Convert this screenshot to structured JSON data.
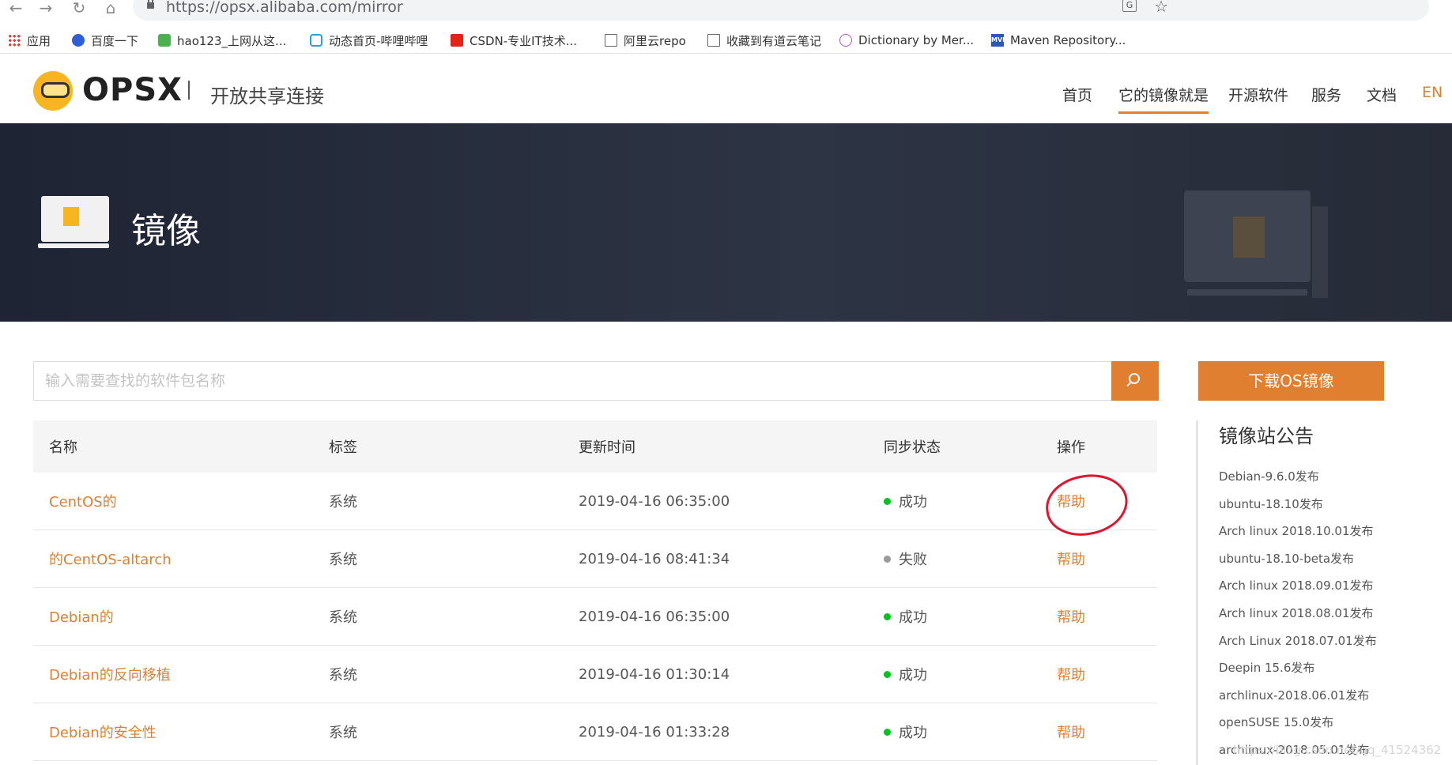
{
  "browser": {
    "url": "https://opsx.alibaba.com/mirror",
    "bookmarks": [
      {
        "label": "应用",
        "icon": "apps-icon"
      },
      {
        "label": "百度一下",
        "icon": "baidu-icon"
      },
      {
        "label": "hao123_上网从这...",
        "icon": "hao123-icon"
      },
      {
        "label": "动态首页-哔哩哔哩",
        "icon": "bilibili-icon"
      },
      {
        "label": "CSDN-专业IT技术...",
        "icon": "csdn-icon"
      },
      {
        "label": "阿里云repo",
        "icon": "page-icon"
      },
      {
        "label": "收藏到有道云笔记",
        "icon": "page-icon"
      },
      {
        "label": "Dictionary by Mer...",
        "icon": "dictionary-icon"
      },
      {
        "label": "Maven Repository...",
        "icon": "maven-icon"
      }
    ]
  },
  "header": {
    "logo_text": "OPSX",
    "slogan": "开放共享连接",
    "nav": [
      {
        "label": "首页"
      },
      {
        "label": "它的镜像就是"
      },
      {
        "label": "开源软件"
      },
      {
        "label": "服务"
      },
      {
        "label": "文档"
      },
      {
        "label": "EN"
      }
    ]
  },
  "banner": {
    "title": "镜像"
  },
  "search": {
    "placeholder": "输入需要查找的软件包名称"
  },
  "download_button": "下载OS镜像",
  "table": {
    "headers": [
      "名称",
      "标签",
      "更新时间",
      "同步状态",
      "操作"
    ],
    "rows": [
      {
        "name": "CentOS的",
        "tag": "系统",
        "time": "2019-04-16 06:35:00",
        "status": "成功",
        "op": "帮助"
      },
      {
        "name": "的CentOS-altarch",
        "tag": "系统",
        "time": "2019-04-16 08:41:34",
        "status": "失败",
        "op": "帮助"
      },
      {
        "name": "Debian的",
        "tag": "系统",
        "time": "2019-04-16 06:35:00",
        "status": "成功",
        "op": "帮助"
      },
      {
        "name": "Debian的反向移植",
        "tag": "系统",
        "time": "2019-04-16 01:30:14",
        "status": "成功",
        "op": "帮助"
      },
      {
        "name": "Debian的安全性",
        "tag": "系统",
        "time": "2019-04-16 01:33:28",
        "status": "成功",
        "op": "帮助"
      }
    ]
  },
  "announcements": {
    "title": "镜像站公告",
    "items": [
      "Debian-9.6.0发布",
      "ubuntu-18.10发布",
      "Arch linux 2018.10.01发布",
      "ubuntu-18.10-beta发布",
      "Arch linux 2018.09.01发布",
      "Arch linux 2018.08.01发布",
      "Arch Linux 2018.07.01发布",
      "Deepin 15.6发布",
      "archlinux-2018.06.01发布",
      "openSUSE 15.0发布",
      "archlinux-2018.05.01发布"
    ]
  },
  "watermark": "https://blog.csdn.net/qq_41524362",
  "colors": {
    "accent": "#e07f30",
    "success": "#00c41e",
    "fail": "#9a9a9a",
    "annotation": "#e0142c"
  }
}
